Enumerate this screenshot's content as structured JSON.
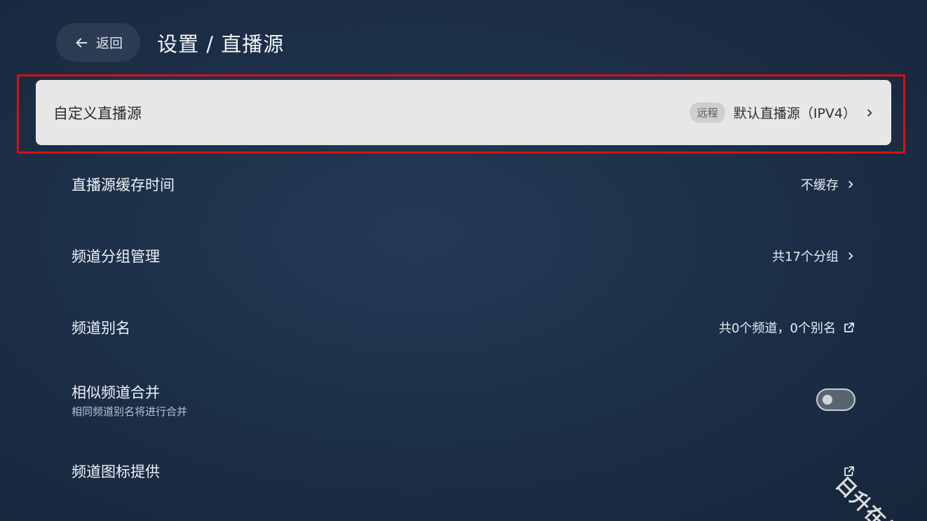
{
  "header": {
    "back_label": "返回",
    "title": "设置 / 直播源"
  },
  "rows": [
    {
      "label": "自定义直播源",
      "tag": "远程",
      "value": "默认直播源（IPV4）",
      "icon": "chevron-right-icon"
    },
    {
      "label": "直播源缓存时间",
      "value": "不缓存",
      "icon": "chevron-right-icon"
    },
    {
      "label": "频道分组管理",
      "value": "共17个分组",
      "icon": "chevron-right-icon"
    },
    {
      "label": "频道别名",
      "value": "共0个频道，0个别名",
      "icon": "external-link-icon"
    },
    {
      "label": "相似频道合并",
      "sublabel": "相同频道别名将进行合并",
      "toggle": false
    },
    {
      "label": "频道图标提供",
      "value": "",
      "icon": "external-link-icon"
    }
  ],
  "watermark": "日升在线",
  "colors": {
    "focus_border": "#d90f12",
    "focused_bg": "#e7e7e7",
    "background": "#1d3049"
  }
}
